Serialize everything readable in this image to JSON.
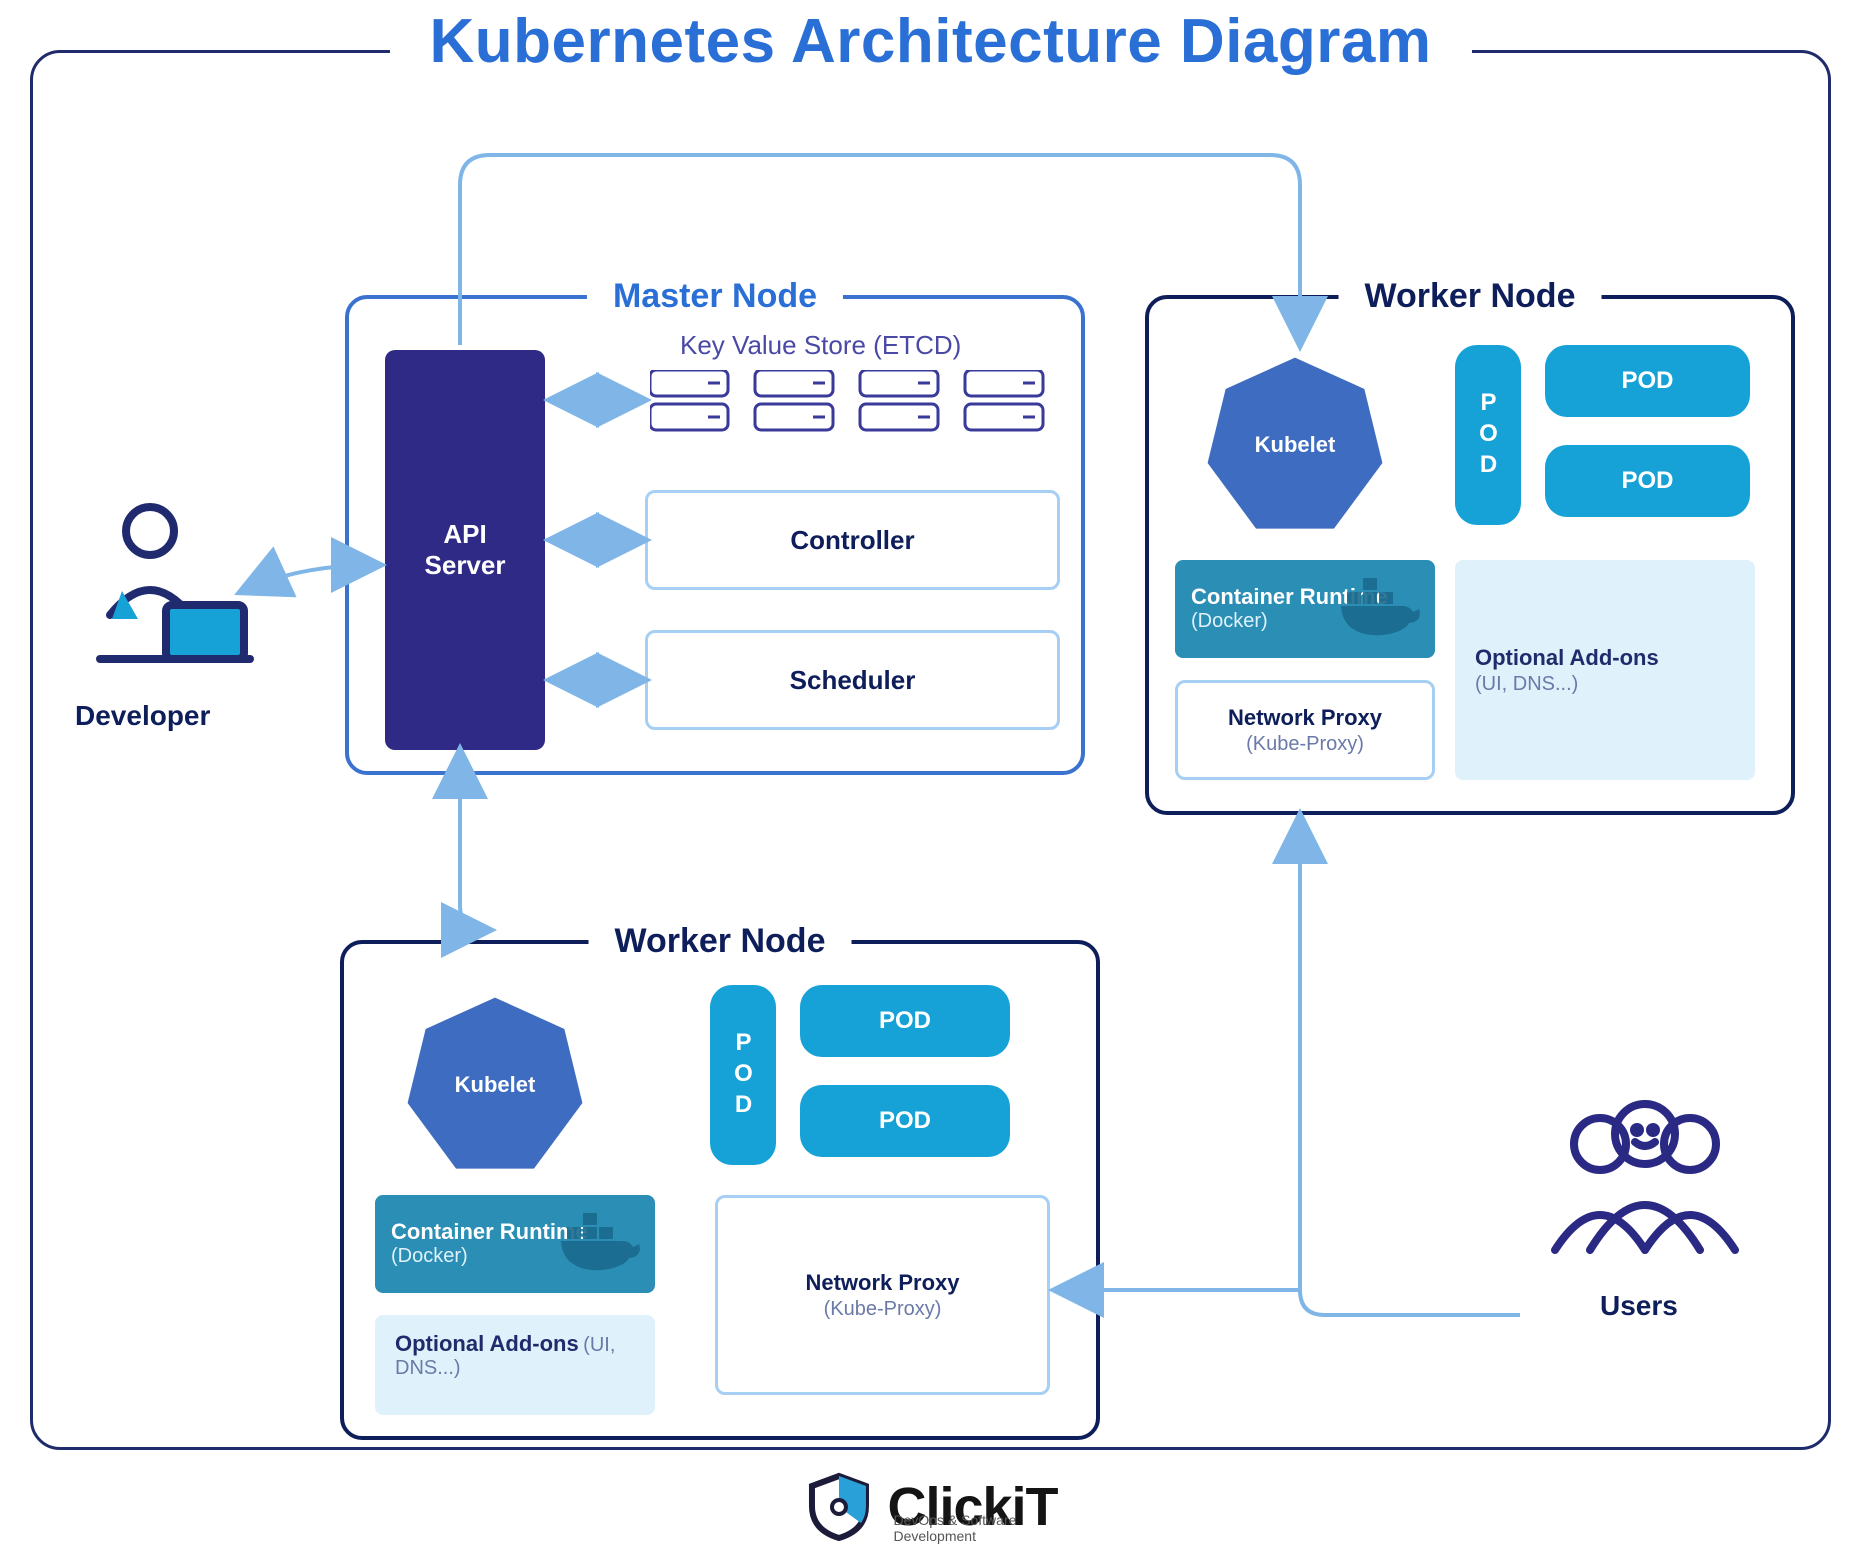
{
  "diagram": {
    "title": "Kubernetes Architecture Diagram"
  },
  "actors": {
    "developer_label": "Developer",
    "users_label": "Users"
  },
  "master": {
    "legend": "Master Node",
    "api_server": "API\nServer",
    "etcd_caption": "Key Value Store (ETCD)",
    "controller": "Controller",
    "scheduler": "Scheduler"
  },
  "worker": {
    "legend": "Worker Node",
    "kubelet": "Kubelet",
    "runtime_title": "Container Runtime",
    "runtime_sub": "(Docker)",
    "addons_title": "Optional Add-ons",
    "addons_sub": "(UI, DNS...)",
    "netproxy_title": "Network Proxy",
    "netproxy_sub": "(Kube-Proxy)",
    "pod": "POD"
  },
  "brand": {
    "name": "ClickiT",
    "tagline": "DevOps & Software Development"
  },
  "colors": {
    "navy": "#1f2b6b",
    "brightblue": "#2a6fd6",
    "indigo": "#2f2a85",
    "cyan": "#16a2d7",
    "teal": "#2a8eb5"
  },
  "arrows": [
    {
      "name": "developer-to-api",
      "kind": "bi"
    },
    {
      "name": "api-to-etcd",
      "kind": "bi"
    },
    {
      "name": "api-to-controller",
      "kind": "bi"
    },
    {
      "name": "api-to-scheduler",
      "kind": "bi"
    },
    {
      "name": "api-loop-top-to-worker1",
      "kind": "uni"
    },
    {
      "name": "api-to-worker2",
      "kind": "bi"
    },
    {
      "name": "users-to-worker1",
      "kind": "uni"
    },
    {
      "name": "users-to-worker2",
      "kind": "uni"
    }
  ]
}
